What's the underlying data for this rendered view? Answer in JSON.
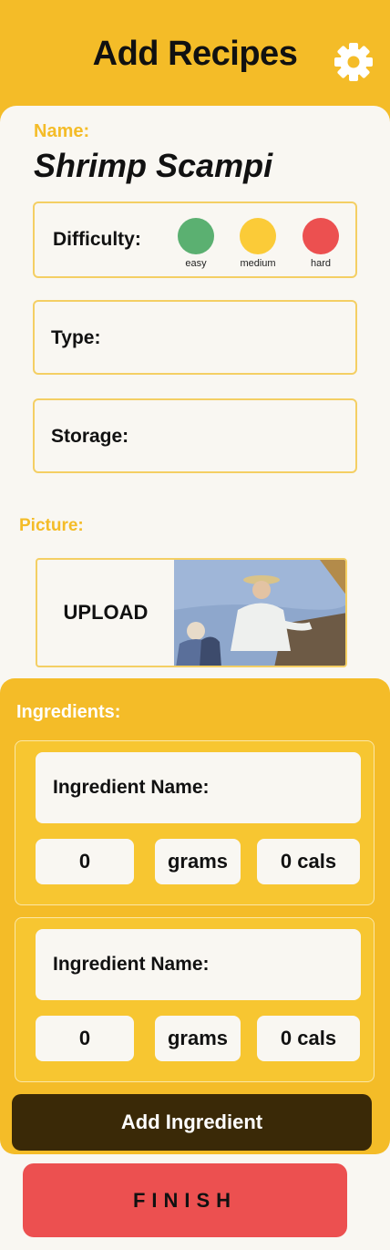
{
  "header": {
    "title": "Add Recipes",
    "settings_icon": "gear-icon"
  },
  "recipe": {
    "name_label": "Name:",
    "name_value": "Shrimp Scampi"
  },
  "difficulty": {
    "label": "Difficulty:",
    "options": [
      {
        "label": "easy",
        "color": "#5bb071"
      },
      {
        "label": "medium",
        "color": "#fbcb38"
      },
      {
        "label": "hard",
        "color": "#ec5050"
      }
    ]
  },
  "type": {
    "label": "Type:"
  },
  "storage": {
    "label": "Storage:"
  },
  "picture": {
    "label": "Picture:",
    "upload_label": "UPLOAD"
  },
  "ingredients": {
    "label": "Ingredients:",
    "items": [
      {
        "name_label": "Ingredient Name:",
        "quantity": "0",
        "unit": "grams",
        "calories": "0 cals"
      },
      {
        "name_label": "Ingredient Name:",
        "quantity": "0",
        "unit": "grams",
        "calories": "0 cals"
      }
    ],
    "add_button": "Add Ingredient"
  },
  "finish_button": "FINISH",
  "colors": {
    "primary": "#f4bc28",
    "finish": "#ec5050",
    "dark": "#3a2907",
    "background": "#f9f7f2"
  }
}
